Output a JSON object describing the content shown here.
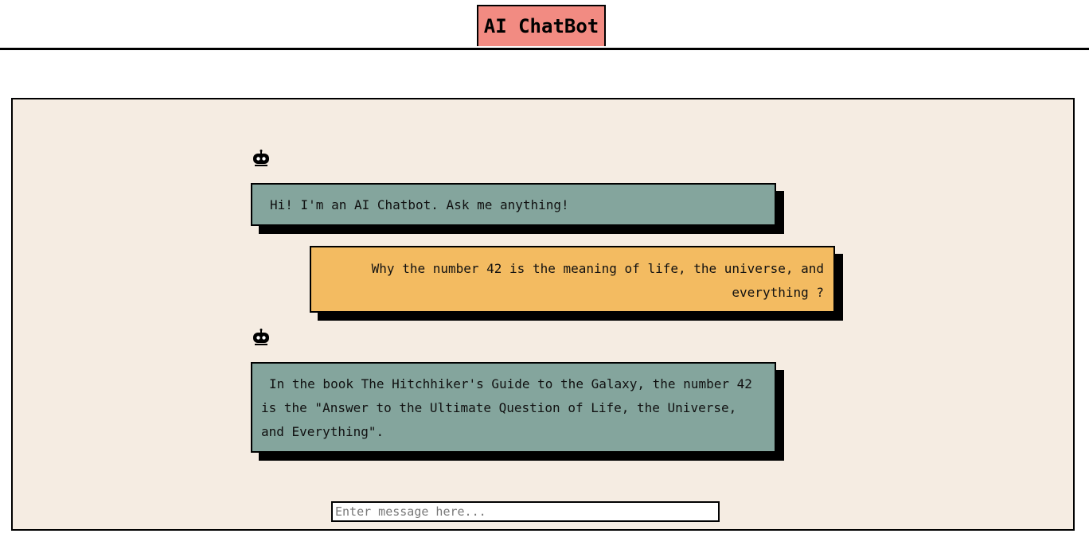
{
  "header": {
    "title": "AI ChatBot"
  },
  "messages": [
    {
      "sender": "bot",
      "icon": "robot-icon",
      "text": "Hi! I'm an AI Chatbot. Ask me anything!"
    },
    {
      "sender": "user",
      "text": "Why the number 42 is the meaning of life, the universe, and everything ?"
    },
    {
      "sender": "bot",
      "icon": "robot-icon",
      "text": "In the book The Hitchhiker's Guide to the Galaxy, the number 42 is the \"Answer to the Ultimate Question of Life, the Universe, and Everything\"."
    }
  ],
  "input": {
    "placeholder": "Enter message here...",
    "value": ""
  },
  "colors": {
    "title_bg": "#f28b82",
    "panel_bg": "#f5ece2",
    "bot_bubble": "#84a59d",
    "user_bubble": "#f3bb61"
  }
}
